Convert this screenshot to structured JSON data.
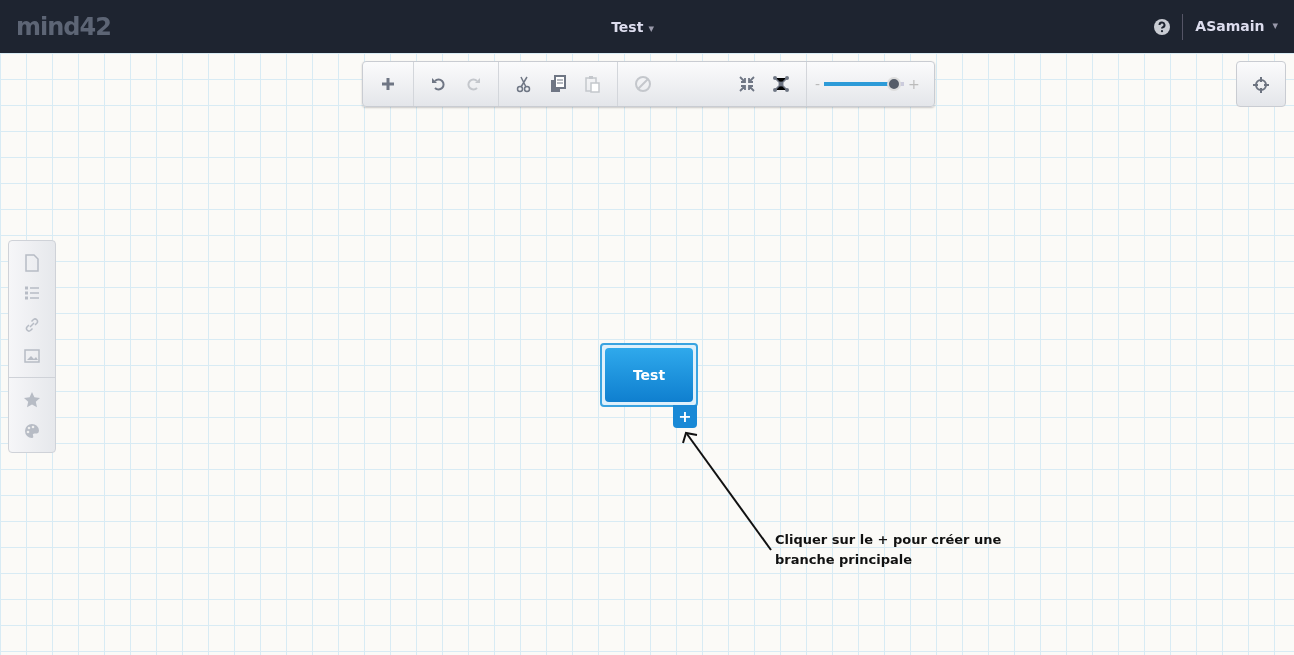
{
  "header": {
    "logo": "mind42",
    "title": "Test",
    "title_caret": "▾",
    "user": "ASamain",
    "user_caret": "▾"
  },
  "toolbar": {
    "groups": [
      [
        {
          "kind": "add",
          "disabled": false
        }
      ],
      [
        {
          "kind": "undo",
          "disabled": false
        },
        {
          "kind": "redo",
          "disabled": true
        }
      ],
      [
        {
          "kind": "cut",
          "disabled": false
        },
        {
          "kind": "copy",
          "disabled": false
        },
        {
          "kind": "paste",
          "disabled": true
        }
      ],
      [
        {
          "kind": "cancel",
          "disabled": true
        },
        {
          "kind": "collapse",
          "disabled": false
        },
        {
          "kind": "layout",
          "disabled": false
        }
      ]
    ],
    "zoom": {
      "minus": "-",
      "plus": "+",
      "level": 0.88
    }
  },
  "sidebar": {
    "groups": [
      [
        {
          "kind": "note"
        },
        {
          "kind": "list"
        },
        {
          "kind": "link"
        },
        {
          "kind": "image"
        }
      ],
      [
        {
          "kind": "star"
        },
        {
          "kind": "palette"
        }
      ]
    ]
  },
  "node": {
    "label": "Test",
    "selected": true,
    "add": "+"
  },
  "annotation": {
    "text": "Cliquer sur le + pour créer une branche principale"
  }
}
